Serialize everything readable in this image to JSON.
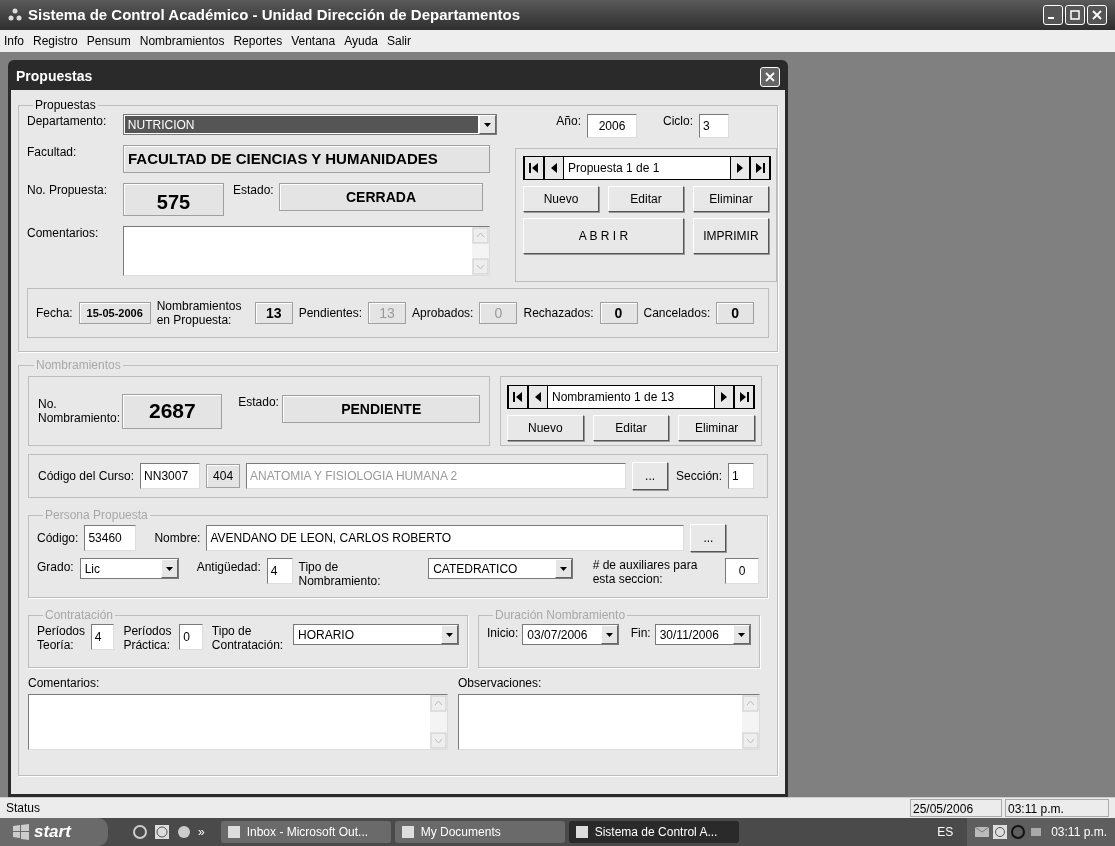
{
  "app": {
    "title": "Sistema de Control Académico - Unidad Dirección de Departamentos"
  },
  "menu": [
    "Info",
    "Registro",
    "Pensum",
    "Nombramientos",
    "Reportes",
    "Ventana",
    "Ayuda",
    "Salir"
  ],
  "window": {
    "title": "Propuestas"
  },
  "propuestas": {
    "group_label": "Propuestas",
    "departamento": {
      "label": "Departamento:",
      "value": "NUTRICION"
    },
    "anio": {
      "label": "Año:",
      "value": "2006"
    },
    "ciclo": {
      "label": "Ciclo:",
      "value": "3"
    },
    "facultad": {
      "label": "Facultad:",
      "value": "FACULTAD DE CIENCIAS Y HUMANIDADES"
    },
    "no_propuesta": {
      "label": "No. Propuesta:",
      "value": "575"
    },
    "estado": {
      "label": "Estado:",
      "value": "CERRADA"
    },
    "comentarios": {
      "label": "Comentarios:"
    },
    "navigator": {
      "record": "Propuesta 1 de 1",
      "buttons": [
        "Nuevo",
        "Editar",
        "Eliminar"
      ]
    },
    "actions": [
      "A B R I R",
      "IMPRIMIR"
    ],
    "summary": [
      {
        "label": "Fecha:",
        "value": "15-05-2006",
        "disabled": false
      },
      {
        "label": "Nombramientos en Propuesta:",
        "value": "13",
        "disabled": false
      },
      {
        "label": "Pendientes:",
        "value": "13",
        "disabled": true
      },
      {
        "label": "Aprobados:",
        "value": "0",
        "disabled": true
      },
      {
        "label": "Rechazados:",
        "value": "0",
        "disabled": false
      },
      {
        "label": "Cancelados:",
        "value": "0",
        "disabled": false
      }
    ]
  },
  "nombramientos": {
    "group_label": "Nombramientos",
    "no_nombramiento": {
      "label": "No. Nombramiento:",
      "value": "2687"
    },
    "estado": {
      "label": "Estado:",
      "value": "PENDIENTE"
    },
    "navigator": {
      "record": "Nombramiento 1 de 13",
      "buttons": [
        "Nuevo",
        "Editar",
        "Eliminar"
      ]
    },
    "curso": {
      "label": "Código del Curso:",
      "code": "NN3007",
      "number": "404",
      "name": "ANATOMIA Y FISIOLOGIA HUMANA 2",
      "browse": "...",
      "seccion_label": "Sección:",
      "seccion": "1"
    },
    "persona": {
      "group_label": "Persona Propuesta",
      "codigo_label": "Código:",
      "codigo": "53460",
      "nombre_label": "Nombre:",
      "nombre": "AVENDANO DE LEON, CARLOS ROBERTO",
      "browse": "...",
      "grado_label": "Grado:",
      "grado": "Lic",
      "antiguedad_label": "Antigüedad:",
      "antiguedad": "4",
      "tipo_label": "Tipo de Nombramiento:",
      "tipo": "CATEDRATICO",
      "auxiliares_label": "# de auxiliares para esta seccion:",
      "auxiliares": "0"
    },
    "contratacion": {
      "group_label": "Contratación",
      "teoria_label": "Períodos Teoría:",
      "teoria": "4",
      "practica_label": "Períodos Práctica:",
      "practica": "0",
      "tipo_label": "Tipo de Contratación:",
      "tipo": "HORARIO"
    },
    "duracion": {
      "group_label": "Duración Nombramiento",
      "inicio_label": "Inicio:",
      "inicio": "03/07/2006",
      "fin_label": "Fin:",
      "fin": "30/11/2006"
    },
    "comentarios_label": "Comentarios:",
    "observaciones_label": "Observaciones:"
  },
  "status_bar": {
    "text": "Status",
    "date": "25/05/2006",
    "time": "03:11 p.m."
  },
  "taskbar": {
    "start": "start",
    "more": "»",
    "tasks": [
      {
        "label": "Inbox - Microsoft Out...",
        "selected": false
      },
      {
        "label": "My Documents",
        "selected": false
      },
      {
        "label": "Sistema de Control A...",
        "selected": true
      }
    ],
    "language": "ES",
    "clock": "03:11 p.m."
  }
}
